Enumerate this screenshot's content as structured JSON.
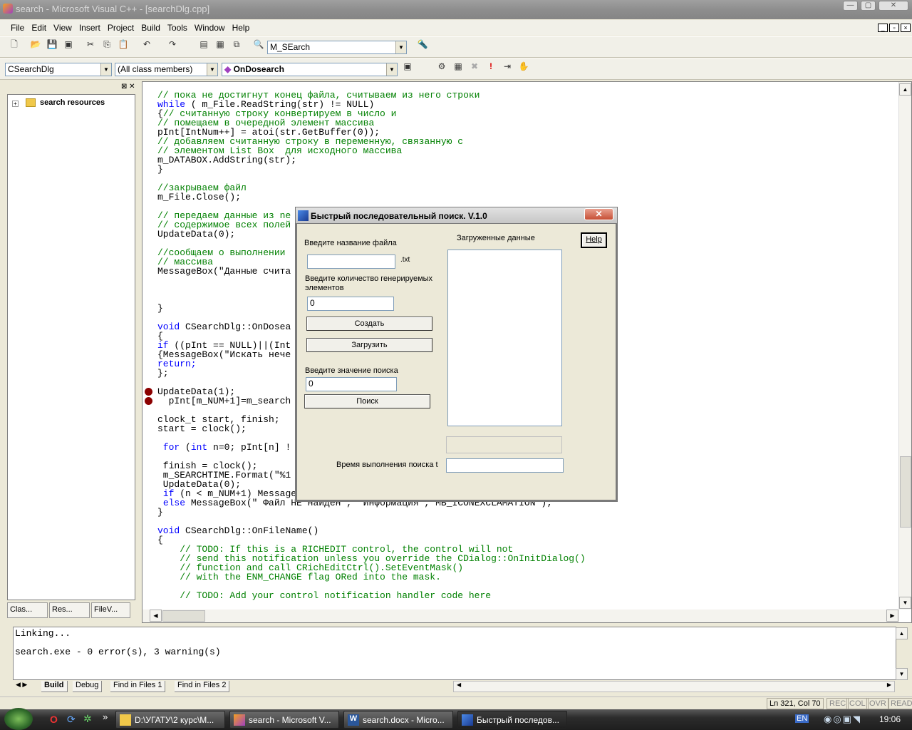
{
  "window": {
    "title": "search - Microsoft Visual C++ - [searchDlg.cpp]"
  },
  "menu": [
    "File",
    "Edit",
    "View",
    "Insert",
    "Project",
    "Build",
    "Tools",
    "Window",
    "Help"
  ],
  "toolbar": {
    "find_combo": "M_SEarch",
    "class_combo": "CSearchDlg",
    "members_combo": "(All class members)",
    "function_combo": "OnDosearch"
  },
  "workspace": {
    "root": "search resources",
    "tabs": [
      "Clas...",
      "Res...",
      "FileV..."
    ]
  },
  "code": [
    {
      "t": "// пока не достигнут конец файла, считываем из него строки",
      "c": "cm"
    },
    {
      "t": "while ( m_File.ReadString(str) != NULL)",
      "c": "kwl",
      "kw": "while"
    },
    {
      "t": "{// считанную строку конвертируем в число и",
      "c": "mix",
      "pre": "{",
      "rest": "// считанную строку конвертируем в число и"
    },
    {
      "t": "// помещаем в очередной элемент массива",
      "c": "cm"
    },
    {
      "t": "pInt[IntNum++] = atoi(str.GetBuffer(0));",
      "c": ""
    },
    {
      "t": "// добавляем считанную строку в переменную, связанную с",
      "c": "cm"
    },
    {
      "t": "// элементом List Box  для исходного массива",
      "c": "cm"
    },
    {
      "t": "m_DATABOX.AddString(str);",
      "c": ""
    },
    {
      "t": "}",
      "c": ""
    },
    {
      "t": "",
      "c": ""
    },
    {
      "t": "//закрываем файл",
      "c": "cm"
    },
    {
      "t": "m_File.Close();",
      "c": ""
    },
    {
      "t": "",
      "c": ""
    },
    {
      "t": "// передаем данные из ne",
      "c": "cm"
    },
    {
      "t": "// содержимое всех полей",
      "c": "cm"
    },
    {
      "t": "UpdateData(0);",
      "c": ""
    },
    {
      "t": "",
      "c": ""
    },
    {
      "t": "//сообщаем о выполнении",
      "c": "cm"
    },
    {
      "t": "// массива",
      "c": "cm"
    },
    {
      "t": "MessageBox(\"Данные считa",
      "c": ""
    },
    {
      "t": "",
      "c": ""
    },
    {
      "t": "",
      "c": ""
    },
    {
      "t": "",
      "c": ""
    },
    {
      "t": "}",
      "c": ""
    },
    {
      "t": "",
      "c": ""
    },
    {
      "t": "void CSearchDlg::OnDosea",
      "c": "kwl",
      "kw": "void"
    },
    {
      "t": "{",
      "c": ""
    },
    {
      "t": "if ((pInt == NULL)||(Int",
      "c": "kwl",
      "kw": "if"
    },
    {
      "t": "{MessageBox(\"Искать нече",
      "c": ""
    },
    {
      "t": "return;",
      "c": "kw"
    },
    {
      "t": "};",
      "c": ""
    },
    {
      "t": "",
      "c": ""
    },
    {
      "t": "UpdateData(1);",
      "c": ""
    },
    {
      "t": "  pInt[m_NUM+1]=m_search",
      "c": ""
    },
    {
      "t": "",
      "c": ""
    },
    {
      "t": "clock_t start, finish;",
      "c": ""
    },
    {
      "t": "start = clock();",
      "c": ""
    },
    {
      "t": "",
      "c": ""
    },
    {
      "t": " for (int n=0; pInt[n] !",
      "c": "kwl2"
    },
    {
      "t": "",
      "c": ""
    },
    {
      "t": " finish = clock();",
      "c": ""
    },
    {
      "t": " m_SEARCHTIME.Format(\"%1",
      "c": ""
    },
    {
      "t": " UpdateData(0);",
      "c": ""
    },
    {
      "t": " if (n < m_NUM+1) MessageBox(\" Файл найден \", \"Информация\", MB_ICONINFORMATION);",
      "c": "kwl3"
    },
    {
      "t": " else MessageBox(\" Файл НЕ найден\", \"Информация\", MB_ICONEXCLAMATION );",
      "c": "kwl4"
    },
    {
      "t": "}",
      "c": ""
    },
    {
      "t": "",
      "c": ""
    },
    {
      "t": "void CSearchDlg::OnFileName()",
      "c": "kwl",
      "kw": "void"
    },
    {
      "t": "{",
      "c": ""
    },
    {
      "t": "    // TODO: If this is a RICHEDIT control, the control will not",
      "c": "cm"
    },
    {
      "t": "    // send this notification unless you override the CDialog::OnInitDialog()",
      "c": "cm"
    },
    {
      "t": "    // function and call CRichEditCtrl().SetEventMask()",
      "c": "cm"
    },
    {
      "t": "    // with the ENM_CHANGE flag ORed into the mask.",
      "c": "cm"
    },
    {
      "t": "",
      "c": ""
    },
    {
      "t": "    // TODO: Add your control notification handler code here",
      "c": "cm"
    }
  ],
  "output": {
    "lines": [
      "Linking...",
      "",
      "search.exe - 0 error(s), 3 warning(s)"
    ],
    "tabs": [
      "Build",
      "Debug",
      "Find in Files 1",
      "Find in Files 2"
    ]
  },
  "status": {
    "position": "Ln 321, Col 70",
    "rec": "REC",
    "col": "COL",
    "ovr": "OVR",
    "read": "READ"
  },
  "dialog": {
    "title": "Быстрый последовательный поиск. V.1.0",
    "file_label": "Введите название файла",
    "file_value": "",
    "file_ext": ".txt",
    "count_label": "Введите количество генерируемых элементов",
    "count_value": "0",
    "create_button": "Создать",
    "load_button": "Загрузить",
    "search_label": "Введите значение поиска",
    "search_value": "0",
    "search_button": "Поиск",
    "loaded_label": "Загруженные данные",
    "help_button": "Help",
    "time_label": "Время выполнения поиска t",
    "time_value": ""
  },
  "taskbar": {
    "tasks": [
      "D:\\УГАТУ\\2 курс\\М...",
      "search - Microsoft V...",
      "search.docx - Micro...",
      "Быстрый последов..."
    ],
    "lang": "EN",
    "clock": "19:06"
  }
}
